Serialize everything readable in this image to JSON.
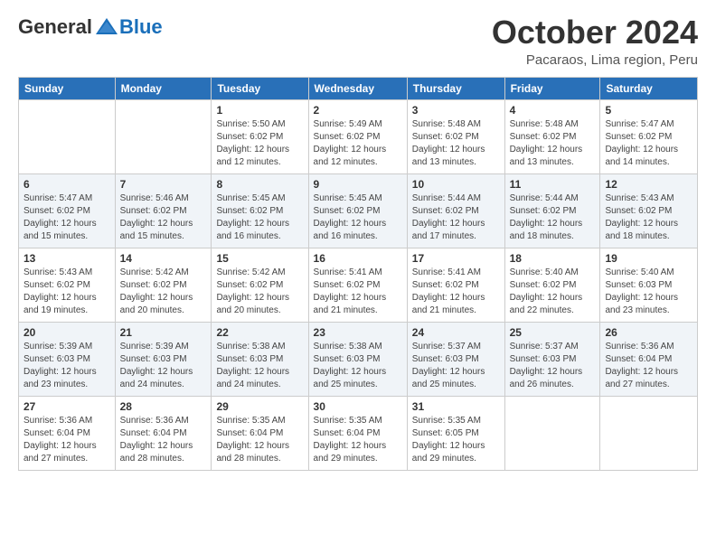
{
  "logo": {
    "general": "General",
    "blue": "Blue"
  },
  "header": {
    "month": "October 2024",
    "location": "Pacaraos, Lima region, Peru"
  },
  "weekdays": [
    "Sunday",
    "Monday",
    "Tuesday",
    "Wednesday",
    "Thursday",
    "Friday",
    "Saturday"
  ],
  "weeks": [
    [
      {
        "day": "",
        "info": ""
      },
      {
        "day": "",
        "info": ""
      },
      {
        "day": "1",
        "info": "Sunrise: 5:50 AM\nSunset: 6:02 PM\nDaylight: 12 hours and 12 minutes."
      },
      {
        "day": "2",
        "info": "Sunrise: 5:49 AM\nSunset: 6:02 PM\nDaylight: 12 hours and 12 minutes."
      },
      {
        "day": "3",
        "info": "Sunrise: 5:48 AM\nSunset: 6:02 PM\nDaylight: 12 hours and 13 minutes."
      },
      {
        "day": "4",
        "info": "Sunrise: 5:48 AM\nSunset: 6:02 PM\nDaylight: 12 hours and 13 minutes."
      },
      {
        "day": "5",
        "info": "Sunrise: 5:47 AM\nSunset: 6:02 PM\nDaylight: 12 hours and 14 minutes."
      }
    ],
    [
      {
        "day": "6",
        "info": "Sunrise: 5:47 AM\nSunset: 6:02 PM\nDaylight: 12 hours and 15 minutes."
      },
      {
        "day": "7",
        "info": "Sunrise: 5:46 AM\nSunset: 6:02 PM\nDaylight: 12 hours and 15 minutes."
      },
      {
        "day": "8",
        "info": "Sunrise: 5:45 AM\nSunset: 6:02 PM\nDaylight: 12 hours and 16 minutes."
      },
      {
        "day": "9",
        "info": "Sunrise: 5:45 AM\nSunset: 6:02 PM\nDaylight: 12 hours and 16 minutes."
      },
      {
        "day": "10",
        "info": "Sunrise: 5:44 AM\nSunset: 6:02 PM\nDaylight: 12 hours and 17 minutes."
      },
      {
        "day": "11",
        "info": "Sunrise: 5:44 AM\nSunset: 6:02 PM\nDaylight: 12 hours and 18 minutes."
      },
      {
        "day": "12",
        "info": "Sunrise: 5:43 AM\nSunset: 6:02 PM\nDaylight: 12 hours and 18 minutes."
      }
    ],
    [
      {
        "day": "13",
        "info": "Sunrise: 5:43 AM\nSunset: 6:02 PM\nDaylight: 12 hours and 19 minutes."
      },
      {
        "day": "14",
        "info": "Sunrise: 5:42 AM\nSunset: 6:02 PM\nDaylight: 12 hours and 20 minutes."
      },
      {
        "day": "15",
        "info": "Sunrise: 5:42 AM\nSunset: 6:02 PM\nDaylight: 12 hours and 20 minutes."
      },
      {
        "day": "16",
        "info": "Sunrise: 5:41 AM\nSunset: 6:02 PM\nDaylight: 12 hours and 21 minutes."
      },
      {
        "day": "17",
        "info": "Sunrise: 5:41 AM\nSunset: 6:02 PM\nDaylight: 12 hours and 21 minutes."
      },
      {
        "day": "18",
        "info": "Sunrise: 5:40 AM\nSunset: 6:02 PM\nDaylight: 12 hours and 22 minutes."
      },
      {
        "day": "19",
        "info": "Sunrise: 5:40 AM\nSunset: 6:03 PM\nDaylight: 12 hours and 23 minutes."
      }
    ],
    [
      {
        "day": "20",
        "info": "Sunrise: 5:39 AM\nSunset: 6:03 PM\nDaylight: 12 hours and 23 minutes."
      },
      {
        "day": "21",
        "info": "Sunrise: 5:39 AM\nSunset: 6:03 PM\nDaylight: 12 hours and 24 minutes."
      },
      {
        "day": "22",
        "info": "Sunrise: 5:38 AM\nSunset: 6:03 PM\nDaylight: 12 hours and 24 minutes."
      },
      {
        "day": "23",
        "info": "Sunrise: 5:38 AM\nSunset: 6:03 PM\nDaylight: 12 hours and 25 minutes."
      },
      {
        "day": "24",
        "info": "Sunrise: 5:37 AM\nSunset: 6:03 PM\nDaylight: 12 hours and 25 minutes."
      },
      {
        "day": "25",
        "info": "Sunrise: 5:37 AM\nSunset: 6:03 PM\nDaylight: 12 hours and 26 minutes."
      },
      {
        "day": "26",
        "info": "Sunrise: 5:36 AM\nSunset: 6:04 PM\nDaylight: 12 hours and 27 minutes."
      }
    ],
    [
      {
        "day": "27",
        "info": "Sunrise: 5:36 AM\nSunset: 6:04 PM\nDaylight: 12 hours and 27 minutes."
      },
      {
        "day": "28",
        "info": "Sunrise: 5:36 AM\nSunset: 6:04 PM\nDaylight: 12 hours and 28 minutes."
      },
      {
        "day": "29",
        "info": "Sunrise: 5:35 AM\nSunset: 6:04 PM\nDaylight: 12 hours and 28 minutes."
      },
      {
        "day": "30",
        "info": "Sunrise: 5:35 AM\nSunset: 6:04 PM\nDaylight: 12 hours and 29 minutes."
      },
      {
        "day": "31",
        "info": "Sunrise: 5:35 AM\nSunset: 6:05 PM\nDaylight: 12 hours and 29 minutes."
      },
      {
        "day": "",
        "info": ""
      },
      {
        "day": "",
        "info": ""
      }
    ]
  ]
}
